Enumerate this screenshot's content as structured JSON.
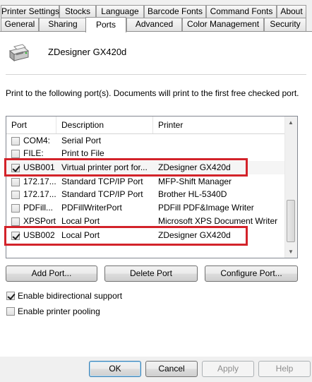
{
  "tabs_top": [
    "Printer Settings",
    "Stocks",
    "Language",
    "Barcode Fonts",
    "Command Fonts",
    "About"
  ],
  "tabs_bottom": [
    "General",
    "Sharing",
    "Ports",
    "Advanced",
    "Color Management",
    "Security"
  ],
  "active_tab": "Ports",
  "printer": {
    "name": "ZDesigner GX420d",
    "icon": "printer-icon"
  },
  "instruction": "Print to the following port(s). Documents will print to the first free checked port.",
  "ports_list": {
    "columns": [
      "Port",
      "Description",
      "Printer"
    ],
    "rows": [
      {
        "checked": false,
        "port": "COM4:",
        "description": "Serial Port",
        "printer": ""
      },
      {
        "checked": false,
        "port": "FILE:",
        "description": "Print to File",
        "printer": ""
      },
      {
        "checked": true,
        "port": "USB001",
        "description": "Virtual printer port for...",
        "printer": "ZDesigner GX420d"
      },
      {
        "checked": false,
        "port": "172.17....",
        "description": "Standard TCP/IP Port",
        "printer": "MFP-Shift Manager"
      },
      {
        "checked": false,
        "port": "172.17....",
        "description": "Standard TCP/IP Port",
        "printer": "Brother HL-5340D"
      },
      {
        "checked": false,
        "port": "PDFill...",
        "description": "PDFillWriterPort",
        "printer": "PDFill PDF&Image Writer"
      },
      {
        "checked": false,
        "port": "XPSPort:",
        "description": "Local Port",
        "printer": "Microsoft XPS Document Writer"
      },
      {
        "checked": true,
        "port": "USB002",
        "description": "Local Port",
        "printer": "ZDesigner GX420d"
      }
    ],
    "highlight_color": "#d3232a"
  },
  "port_buttons": {
    "add": "Add Port...",
    "delete": "Delete Port",
    "configure": "Configure Port..."
  },
  "options": {
    "bidirectional": {
      "label": "Enable bidirectional support",
      "checked": true
    },
    "pooling": {
      "label": "Enable printer pooling",
      "checked": false
    }
  },
  "dialog_buttons": {
    "ok": "OK",
    "cancel": "Cancel",
    "apply": "Apply",
    "help": "Help"
  }
}
